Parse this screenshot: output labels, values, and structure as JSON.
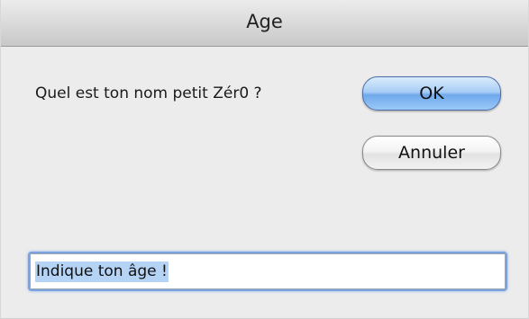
{
  "window": {
    "title": "Age"
  },
  "dialog": {
    "prompt": "Quel est ton nom petit Zér0 ?",
    "ok_label": "OK",
    "cancel_label": "Annuler",
    "input_value": "Indique ton âge !",
    "input_text_selected": true
  },
  "colors": {
    "default_button": "#8bbcf2",
    "selection_highlight": "#b5d3f5",
    "focus_ring": "#7aa3df"
  }
}
